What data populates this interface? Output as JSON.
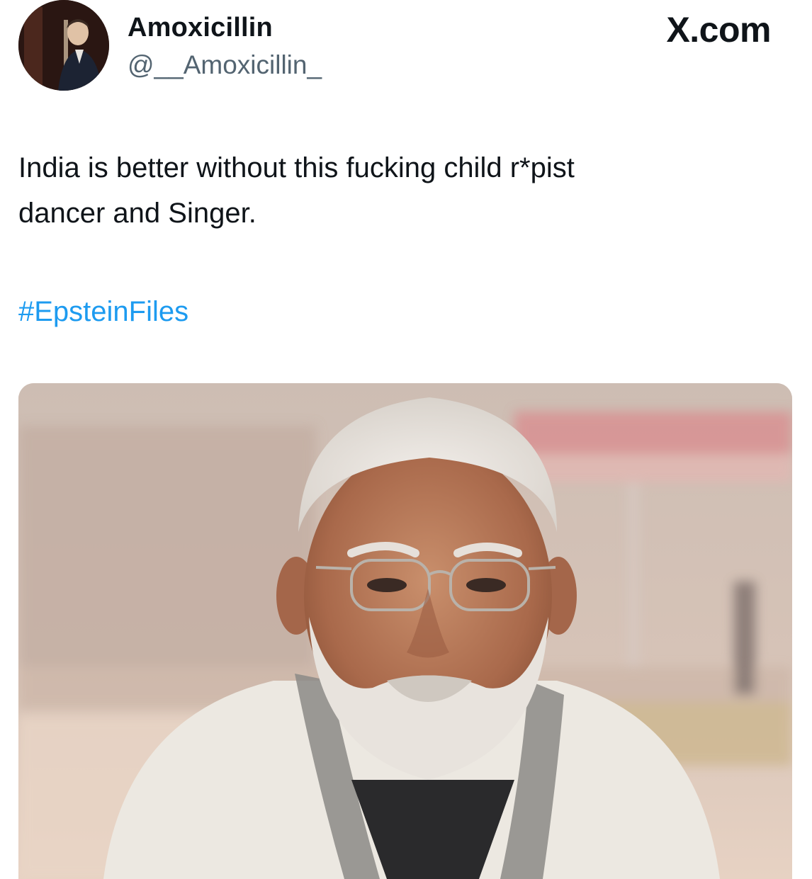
{
  "author": {
    "display_name": "Amoxicillin",
    "handle": "@__Amoxicillin_"
  },
  "brand": {
    "label": "X.com"
  },
  "post": {
    "text_line1": "India is better without this fucking child r*pist",
    "text_line2": "dancer and Singer.",
    "hashtag": "#EpsteinFiles"
  },
  "colors": {
    "hashtag": "#1d9bf0",
    "handle": "#536471",
    "text": "#0f1419"
  },
  "icons": {
    "avatar": "profile-photo",
    "brand": "x-logo"
  }
}
